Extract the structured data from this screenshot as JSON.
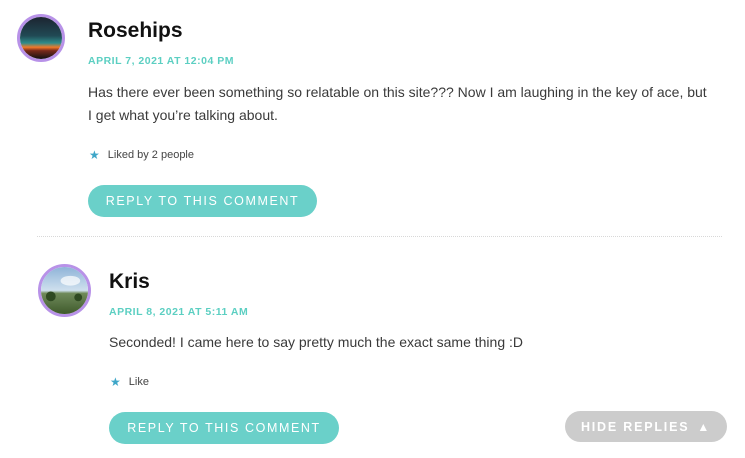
{
  "comments": [
    {
      "author": "Rosehips",
      "date": "APRIL 7, 2021 AT 12:04 PM",
      "text_line1": "Has there ever been something so relatable on this site??? Now I am laughing in the key of ace, but",
      "text_line2": "I get what you’re talking about.",
      "likes": "Liked by 2 people",
      "reply_label": "REPLY TO THIS COMMENT",
      "avatar_icon": "sunset-avatar-icon"
    },
    {
      "author": "Kris",
      "date": "APRIL 8, 2021 AT 5:11 AM",
      "text_line1": "Seconded! I came here to say pretty much the exact same thing :D",
      "likes": "Like",
      "reply_label": "REPLY TO THIS COMMENT",
      "avatar_icon": "landscape-avatar-icon"
    }
  ],
  "hide_replies": {
    "label": "HIDE REPLIES",
    "icon": "triangle-up-icon"
  },
  "colors": {
    "accent": "#6ad0c9",
    "date": "#5ccfc2",
    "avatar_border": "#b892e8",
    "hide_btn": "#cccccc"
  }
}
